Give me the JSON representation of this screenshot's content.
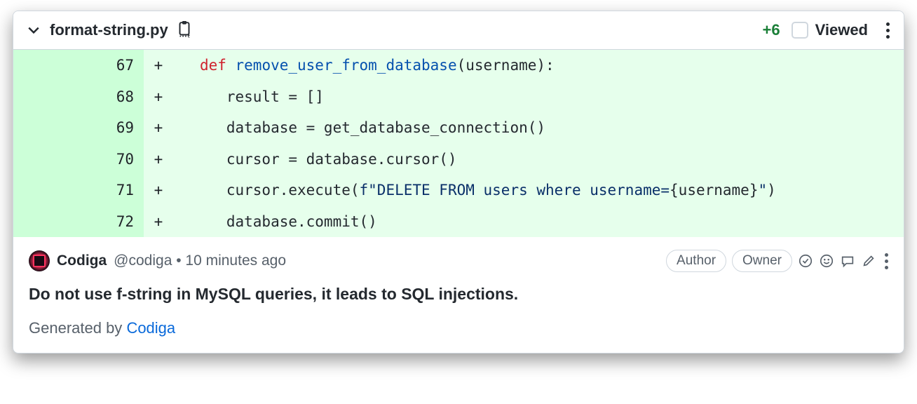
{
  "file": {
    "name": "format-string.py",
    "additions": "+6",
    "viewed_label": "Viewed",
    "viewed_checked": false
  },
  "diff": {
    "lines": [
      {
        "num": "67",
        "marker": "+",
        "indent": "   ",
        "tokens": [
          {
            "t": "def ",
            "c": "kw"
          },
          {
            "t": "remove_user_from_database",
            "c": "fn"
          },
          {
            "t": "(username):",
            "c": ""
          }
        ]
      },
      {
        "num": "68",
        "marker": "+",
        "indent": "      ",
        "tokens": [
          {
            "t": "result = []",
            "c": ""
          }
        ]
      },
      {
        "num": "69",
        "marker": "+",
        "indent": "      ",
        "tokens": [
          {
            "t": "database = get_database_connection()",
            "c": ""
          }
        ]
      },
      {
        "num": "70",
        "marker": "+",
        "indent": "      ",
        "tokens": [
          {
            "t": "cursor = database.cursor()",
            "c": ""
          }
        ]
      },
      {
        "num": "71",
        "marker": "+",
        "indent": "      ",
        "tokens": [
          {
            "t": "cursor.execute(",
            "c": ""
          },
          {
            "t": "f\"DELETE FROM users where username=",
            "c": "str"
          },
          {
            "t": "{username}",
            "c": ""
          },
          {
            "t": "\"",
            "c": "str"
          },
          {
            "t": ")",
            "c": ""
          }
        ]
      },
      {
        "num": "72",
        "marker": "+",
        "indent": "      ",
        "tokens": [
          {
            "t": "database.commit()",
            "c": ""
          }
        ]
      }
    ]
  },
  "comment": {
    "author": "Codiga",
    "handle": "@codiga",
    "sep": " • ",
    "time": "10 minutes ago",
    "badges": {
      "author": "Author",
      "owner": "Owner"
    },
    "body": "Do not use f-string in MySQL queries, it leads to SQL injections.",
    "footer_prefix": "Generated by ",
    "footer_link": "Codiga"
  }
}
